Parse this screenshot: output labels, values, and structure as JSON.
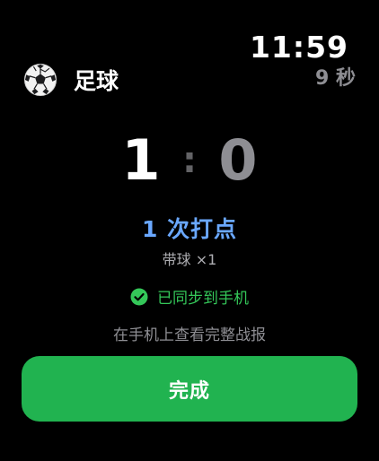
{
  "status": {
    "time": "11:59",
    "elapsed": "9 秒"
  },
  "header": {
    "icon": "soccer-ball-icon",
    "title": "足球"
  },
  "score": {
    "home": "1",
    "separator": ":",
    "away": "0"
  },
  "summary": {
    "hits": "1 次打点",
    "detail": "带球 ×1"
  },
  "sync": {
    "icon": "check-circle-icon",
    "text": "已同步到手机"
  },
  "hint": "在手机上查看完整战报",
  "actions": {
    "done_label": "完成"
  },
  "colors": {
    "background": "#000000",
    "accent_blue": "#6aa8ff",
    "success_green": "#34c759",
    "button_green": "#21b350",
    "muted_gray": "#8e8e93"
  }
}
